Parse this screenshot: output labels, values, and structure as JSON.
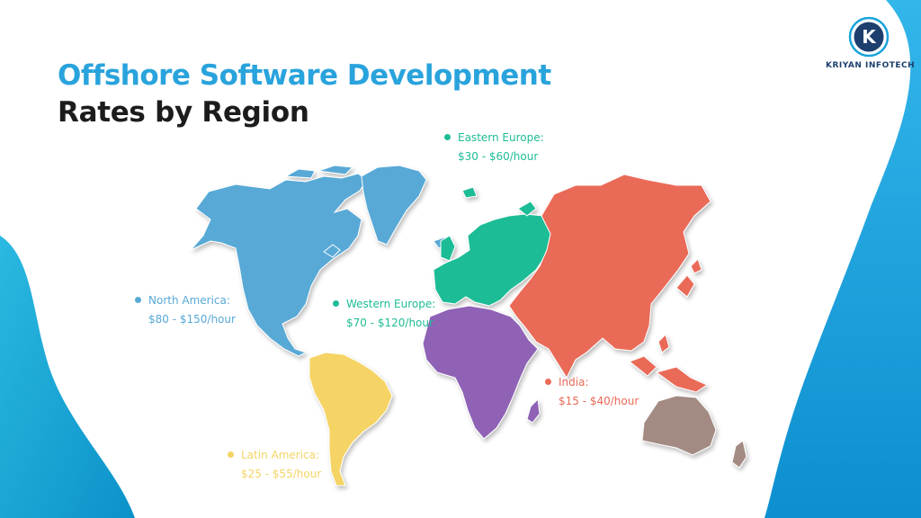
{
  "title": {
    "line1": "Offshore Software Development",
    "line2": "Rates by Region"
  },
  "logo": {
    "letter": "K",
    "name": "KRIYAN INFOTECH"
  },
  "colors": {
    "title_blue": "#29a3dc",
    "north_america": "#58a9d6",
    "latin_america": "#f5d465",
    "western_europe": "#1fbc96",
    "eastern_europe": "#1fbc96",
    "africa": "#8f62b6",
    "asia": "#ea6a58",
    "australia": "#a38b83",
    "wave": "#1aa3dc"
  },
  "regions": [
    {
      "id": "north-america",
      "name": "North America:",
      "rate": "$80 - $150/hour",
      "color": "#58a9d6"
    },
    {
      "id": "western-europe",
      "name": "Western Europe:",
      "rate": "$70 - $120/hour",
      "color": "#1fbc96"
    },
    {
      "id": "eastern-europe",
      "name": "Eastern Europe:",
      "rate": "$30 - $60/hour",
      "color": "#1fbc96"
    },
    {
      "id": "india",
      "name": "India:",
      "rate": "$15 - $40/hour",
      "color": "#ea6a58"
    },
    {
      "id": "latin-america",
      "name": "Latin America:",
      "rate": "$25 - $55/hour",
      "color": "#f5d465"
    }
  ]
}
